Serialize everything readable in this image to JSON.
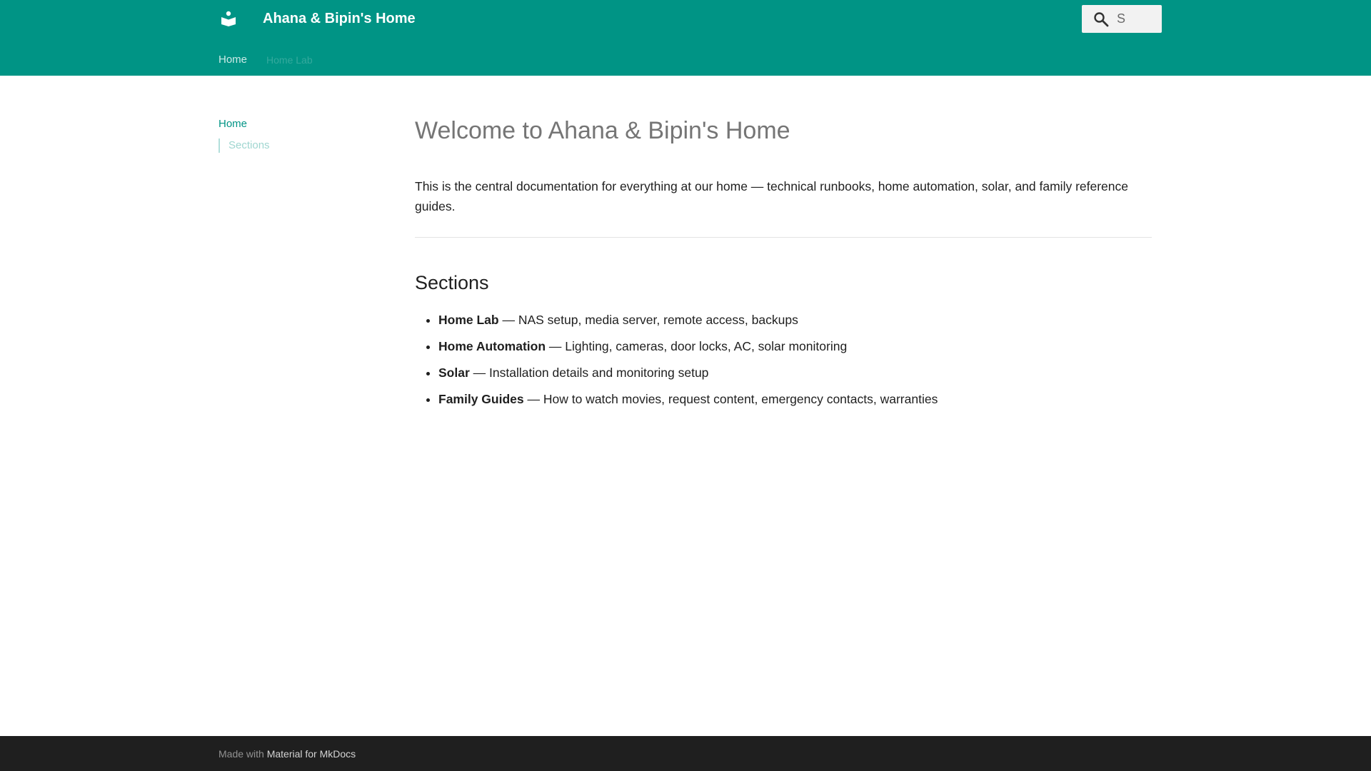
{
  "header": {
    "site_title": "Ahana & Bipin's Home",
    "logo_icon": "open-book-reader-icon",
    "search": {
      "icon": "search-icon",
      "placeholder": "S"
    },
    "tabs": [
      {
        "label": "Home"
      },
      {
        "label": "Home Lab"
      }
    ]
  },
  "sidebar": {
    "home_label": "Home",
    "toc": [
      {
        "label": "Sections"
      }
    ]
  },
  "main": {
    "title": "Welcome to Ahana & Bipin's Home",
    "intro": "This is the central documentation for everything at our home — technical runbooks, home automation, solar, and family reference guides.",
    "sections_heading": "Sections",
    "sections": [
      {
        "name": "Home Lab",
        "description": " — NAS setup, media server, remote access, backups"
      },
      {
        "name": "Home Automation",
        "description": " — Lighting, cameras, door locks, AC, solar monitoring"
      },
      {
        "name": "Solar",
        "description": " — Installation details and monitoring setup"
      },
      {
        "name": "Family Guides",
        "description": " — How to watch movies, request content, emergency contacts, warranties"
      }
    ]
  },
  "footer": {
    "prefix": "Made with ",
    "link_label": "Material for MkDocs"
  },
  "colors": {
    "primary": "#009485",
    "footer_bg": "#1f1f1f",
    "search_bg": "#f2f2f2"
  }
}
